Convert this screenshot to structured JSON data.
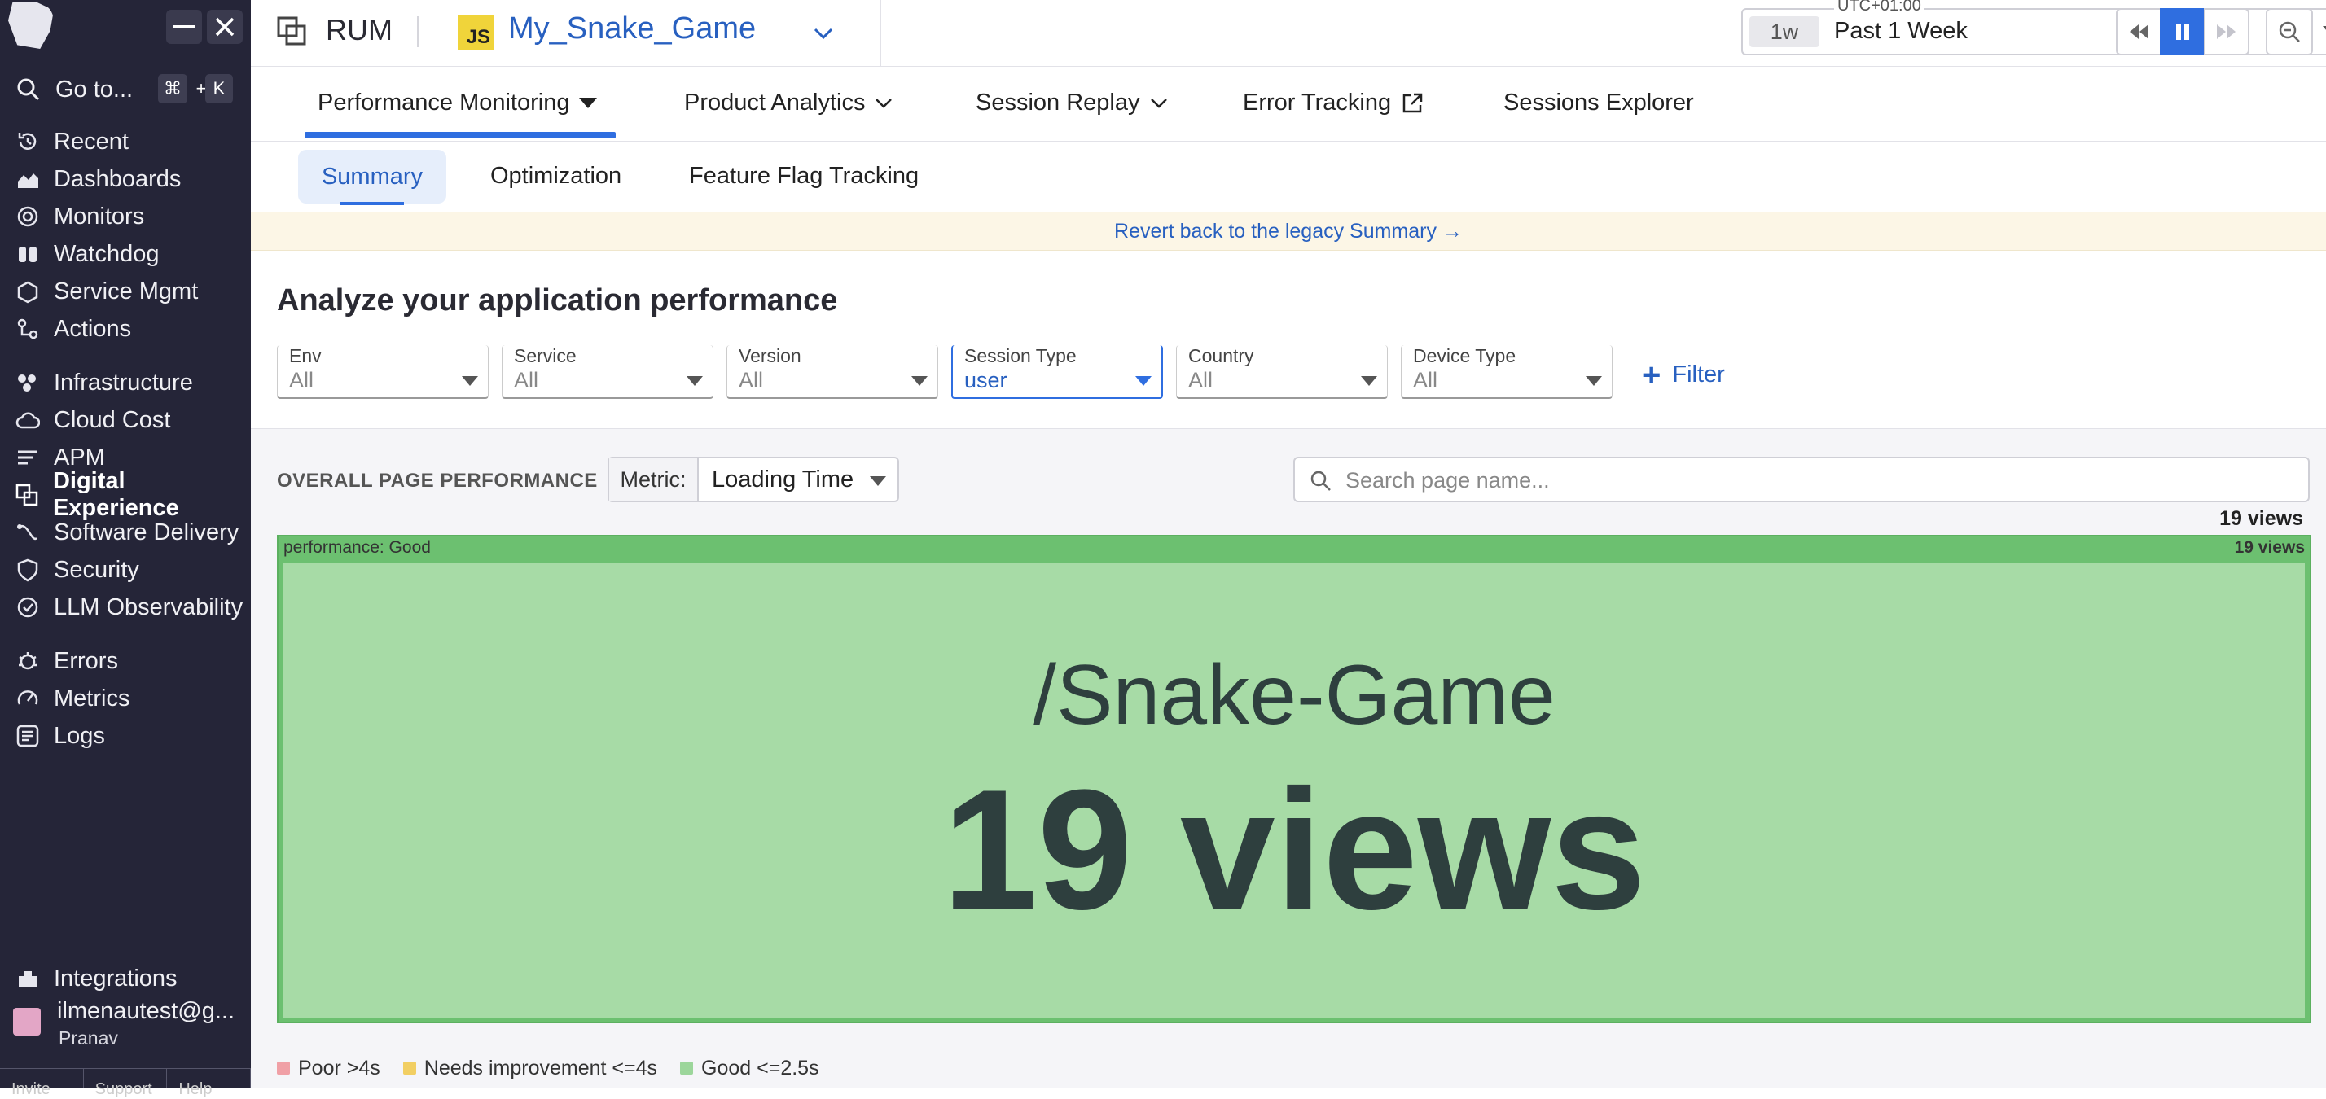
{
  "sidebar": {
    "goto_label": "Go to...",
    "shortcut": {
      "cmd": "⌘",
      "plus": "+",
      "key": "K"
    },
    "items": [
      {
        "label": "Recent",
        "icon": "history-icon"
      },
      {
        "label": "Dashboards",
        "icon": "dashboards-icon"
      },
      {
        "label": "Monitors",
        "icon": "monitors-icon"
      },
      {
        "label": "Watchdog",
        "icon": "binoculars-icon"
      },
      {
        "label": "Service Mgmt",
        "icon": "service-mgmt-icon"
      },
      {
        "label": "Actions",
        "icon": "actions-icon"
      },
      {
        "label": "Infrastructure",
        "icon": "infrastructure-icon"
      },
      {
        "label": "Cloud Cost",
        "icon": "cloud-cost-icon"
      },
      {
        "label": "APM",
        "icon": "apm-icon"
      },
      {
        "label": "Digital Experience",
        "icon": "digital-experience-icon"
      },
      {
        "label": "Software Delivery",
        "icon": "software-delivery-icon"
      },
      {
        "label": "Security",
        "icon": "security-icon"
      },
      {
        "label": "LLM Observability",
        "icon": "llm-observability-icon"
      },
      {
        "label": "Errors",
        "icon": "errors-icon"
      },
      {
        "label": "Metrics",
        "icon": "metrics-icon"
      },
      {
        "label": "Logs",
        "icon": "logs-icon"
      },
      {
        "label": "Integrations",
        "icon": "integrations-icon"
      }
    ],
    "active_item": "Digital Experience",
    "user": {
      "email": "ilmenautest@g...",
      "name": "Pranav"
    },
    "bottom": [
      "Invite",
      "Support",
      "Help"
    ]
  },
  "topbar": {
    "product": "RUM",
    "app_badge": "JS",
    "app_name": "My_Snake_Game",
    "timezone": "UTC+01:00",
    "range_short": "1w",
    "range_label": "Past 1 Week"
  },
  "tabs": {
    "main": [
      "Performance Monitoring",
      "Product Analytics",
      "Session Replay",
      "Error Tracking",
      "Sessions Explorer"
    ],
    "active_main": "Performance Monitoring",
    "sub": [
      "Summary",
      "Optimization",
      "Feature Flag Tracking"
    ],
    "active_sub": "Summary"
  },
  "banner": "Revert back to the legacy Summary →",
  "heading": "Analyze your application performance",
  "filters": [
    {
      "label": "Env",
      "value": "All"
    },
    {
      "label": "Service",
      "value": "All"
    },
    {
      "label": "Version",
      "value": "All"
    },
    {
      "label": "Session Type",
      "value": "user"
    },
    {
      "label": "Country",
      "value": "All"
    },
    {
      "label": "Device Type",
      "value": "All"
    }
  ],
  "add_filter_label": "Filter",
  "performance": {
    "section_title": "OVERALL PAGE PERFORMANCE",
    "metric_label": "Metric:",
    "metric_value": "Loading Time",
    "search_placeholder": "Search page name...",
    "total_views": "19 views",
    "group_label": "performance: Good",
    "group_views": "19 views",
    "page_name": "/Snake-Game",
    "page_views": "19 views",
    "legend": [
      {
        "label": "Poor >4s",
        "color": "#f0a0a6"
      },
      {
        "label": "Needs improvement <=4s",
        "color": "#f2cf63"
      },
      {
        "label": "Good <=2.5s",
        "color": "#9cd69b"
      }
    ]
  },
  "colors": {
    "accent": "#2f6ee0",
    "sidebar_bg": "#252538",
    "good": "#6cc070"
  }
}
